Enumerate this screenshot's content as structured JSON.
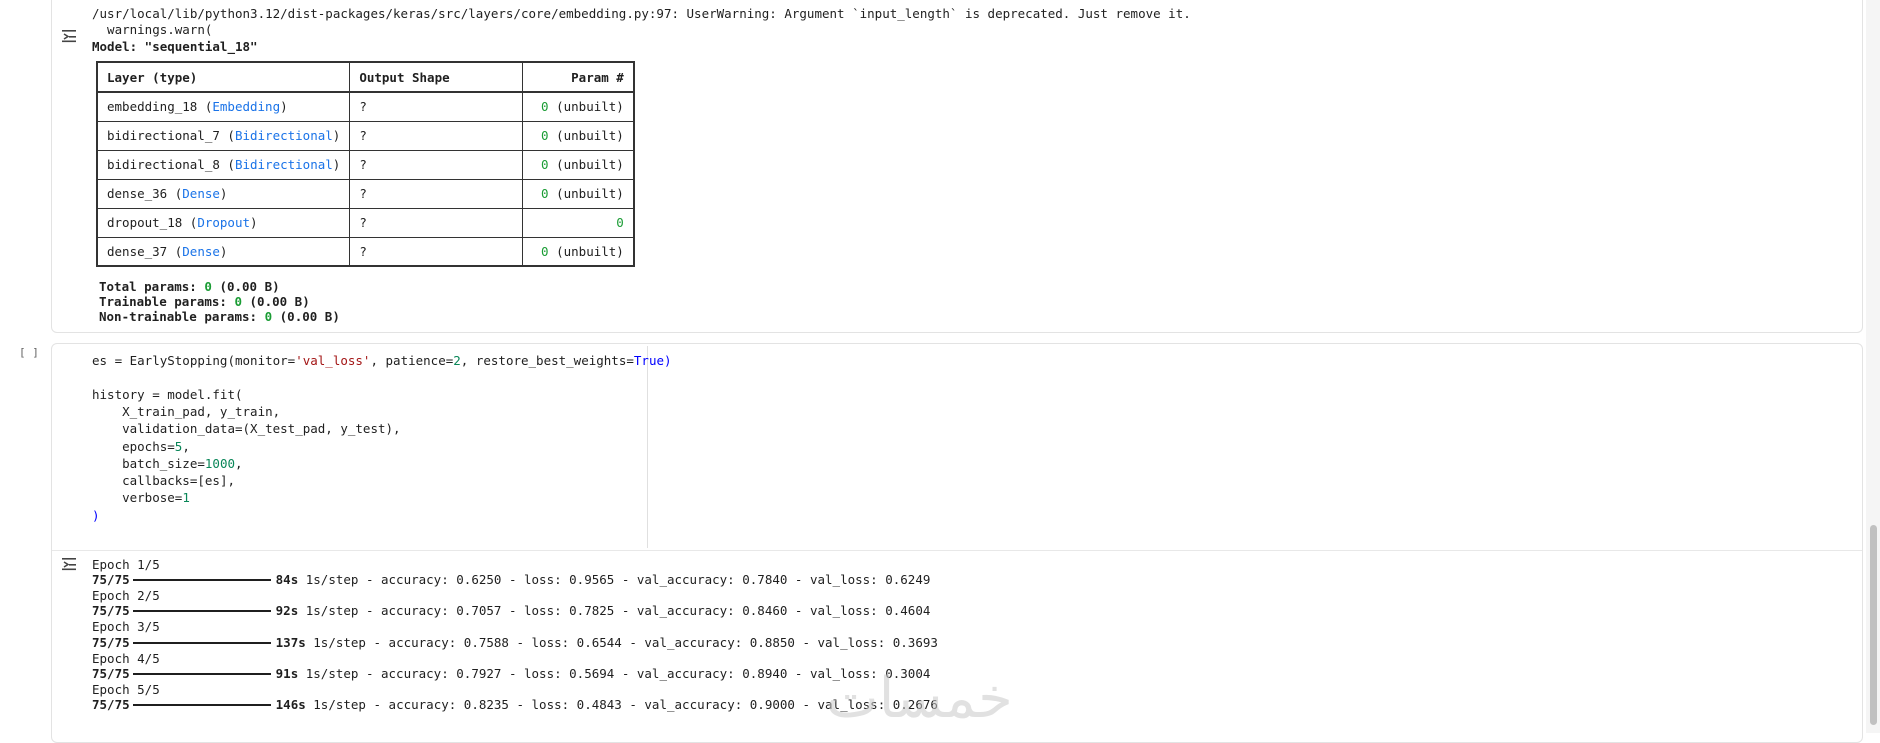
{
  "cell1": {
    "warning_line": "/usr/local/lib/python3.12/dist-packages/keras/src/layers/core/embedding.py:97: UserWarning: Argument `input_length` is deprecated. Just remove it.",
    "warn_call": "  warnings.warn(",
    "model_title": "Model: \"sequential_18\"",
    "headers": [
      "Layer (type)",
      "Output Shape",
      "Param #"
    ],
    "rows": [
      {
        "name": "embedding_18",
        "type": "Embedding",
        "shape": "?",
        "param": "0",
        "suffix": "(unbuilt)"
      },
      {
        "name": "bidirectional_7",
        "type": "Bidirectional",
        "shape": "?",
        "param": "0",
        "suffix": "(unbuilt)"
      },
      {
        "name": "bidirectional_8",
        "type": "Bidirectional",
        "shape": "?",
        "param": "0",
        "suffix": "(unbuilt)"
      },
      {
        "name": "dense_36",
        "type": "Dense",
        "shape": "?",
        "param": "0",
        "suffix": "(unbuilt)"
      },
      {
        "name": "dropout_18",
        "type": "Dropout",
        "shape": "?",
        "param": "0",
        "suffix": ""
      },
      {
        "name": "dense_37",
        "type": "Dense",
        "shape": "?",
        "param": "0",
        "suffix": "(unbuilt)"
      }
    ],
    "totals": [
      {
        "label": "Total params:",
        "value": "0",
        "rest": "(0.00 B)"
      },
      {
        "label": "Trainable params:",
        "value": "0",
        "rest": "(0.00 B)"
      },
      {
        "label": "Non-trainable params:",
        "value": "0",
        "rest": "(0.00 B)"
      }
    ]
  },
  "cell2": {
    "exec_count": "[ ]",
    "code": {
      "l1_a": "es = EarlyStopping(monitor=",
      "l1_str": "'val_loss'",
      "l1_b": ", patience=",
      "l1_num": "2",
      "l1_c": ", restore_best_weights=",
      "l1_kw": "True",
      "l1_d": ")",
      "l3": "history = model.fit(",
      "l4": "    X_train_pad, y_train,",
      "l5_a": "    validation_data=(",
      "l5_b": "X_test_pad, y_test",
      "l5_c": "),",
      "l6_a": "    epochs=",
      "l6_num": "5",
      "l6_b": ",",
      "l7_a": "    batch_size=",
      "l7_num": "1000",
      "l7_b": ",",
      "l8_a": "    callbacks=[",
      "l8_b": "es",
      "l8_c": "],",
      "l9_a": "    verbose=",
      "l9_num": "1",
      "l10": ")"
    },
    "epochs": [
      {
        "label": "Epoch 1/5",
        "steps": "75/75",
        "time": "84s",
        "rest": "1s/step - accuracy: 0.6250 - loss: 0.9565 - val_accuracy: 0.7840 - val_loss: 0.6249"
      },
      {
        "label": "Epoch 2/5",
        "steps": "75/75",
        "time": "92s",
        "rest": "1s/step - accuracy: 0.7057 - loss: 0.7825 - val_accuracy: 0.8460 - val_loss: 0.4604"
      },
      {
        "label": "Epoch 3/5",
        "steps": "75/75",
        "time": "137s",
        "rest": "1s/step - accuracy: 0.7588 - loss: 0.6544 - val_accuracy: 0.8850 - val_loss: 0.3693"
      },
      {
        "label": "Epoch 4/5",
        "steps": "75/75",
        "time": "91s",
        "rest": "1s/step - accuracy: 0.7927 - loss: 0.5694 - val_accuracy: 0.8940 - val_loss: 0.3004"
      },
      {
        "label": "Epoch 5/5",
        "steps": "75/75",
        "time": "146s",
        "rest": "1s/step - accuracy: 0.8235 - loss: 0.4843 - val_accuracy: 0.9000 - val_loss: 0.2676"
      }
    ]
  },
  "watermark": "خمسات",
  "icons": {
    "output_toggle": "output-toggle-icon"
  }
}
